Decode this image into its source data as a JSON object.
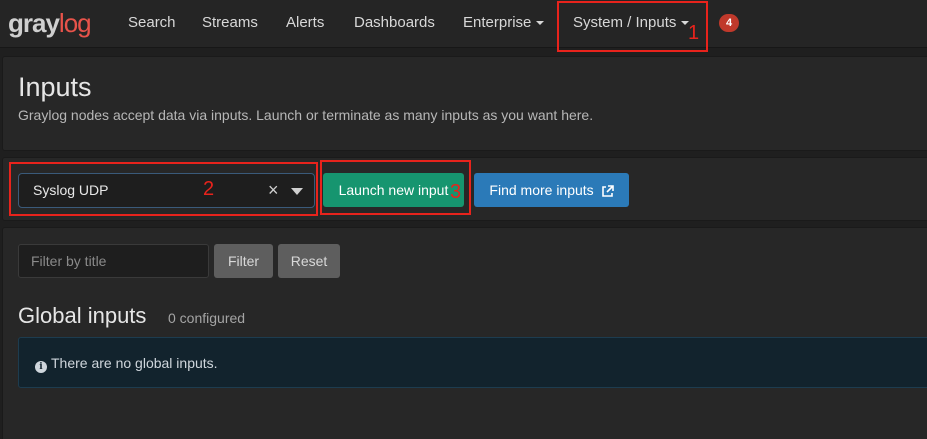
{
  "navbar": {
    "logo_part1": "gray",
    "logo_part2": "log",
    "items": [
      {
        "label": "Search"
      },
      {
        "label": "Streams"
      },
      {
        "label": "Alerts"
      },
      {
        "label": "Dashboards"
      },
      {
        "label": "Enterprise"
      },
      {
        "label": "System / Inputs"
      }
    ],
    "notification_count": "4"
  },
  "page": {
    "title": "Inputs",
    "description": "Graylog nodes accept data via inputs. Launch or terminate as many inputs as you want here."
  },
  "input_select": {
    "selected": "Syslog UDP",
    "clear_symbol": "×"
  },
  "buttons": {
    "launch": "Launch new input",
    "find_more": "Find more inputs"
  },
  "filter": {
    "placeholder": "Filter by title",
    "filter_label": "Filter",
    "reset_label": "Reset"
  },
  "global_inputs": {
    "title": "Global inputs",
    "count": "0 configured",
    "empty_message": "There are no global inputs."
  },
  "annotations": [
    "1",
    "2",
    "3"
  ],
  "colors": {
    "accent_red": "#e8534a",
    "launch_green": "#16956f",
    "find_blue": "#2b7ab8",
    "annotation_red": "#e8231c",
    "badge_red": "#c0392b"
  },
  "icons": {
    "info": "info-circle-icon",
    "external": "external-link-icon",
    "dropdown": "caret-down-icon"
  }
}
